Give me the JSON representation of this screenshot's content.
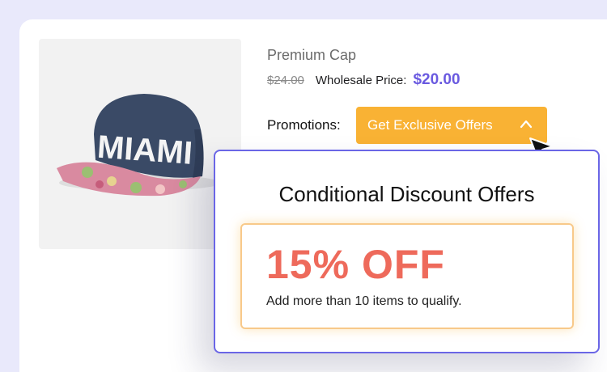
{
  "product": {
    "title": "Premium Cap",
    "original_price": "$24.00",
    "wholesale_label": "Wholesale Price:",
    "wholesale_price": "$20.00",
    "image_icon": "cap-product-image",
    "cap_text": "MIAMI"
  },
  "promotions": {
    "label": "Promotions:",
    "button_label": "Get Exclusive Offers",
    "button_icon": "chevron-up-icon"
  },
  "popover": {
    "title": "Conditional Discount Offers",
    "offer": {
      "discount": "15% OFF",
      "condition": "Add more than 10 items to qualify."
    }
  },
  "colors": {
    "accent": "#6a5ae0",
    "button": "#f9b234",
    "discount": "#ee6a5b",
    "popover_border": "#6a66e6"
  }
}
